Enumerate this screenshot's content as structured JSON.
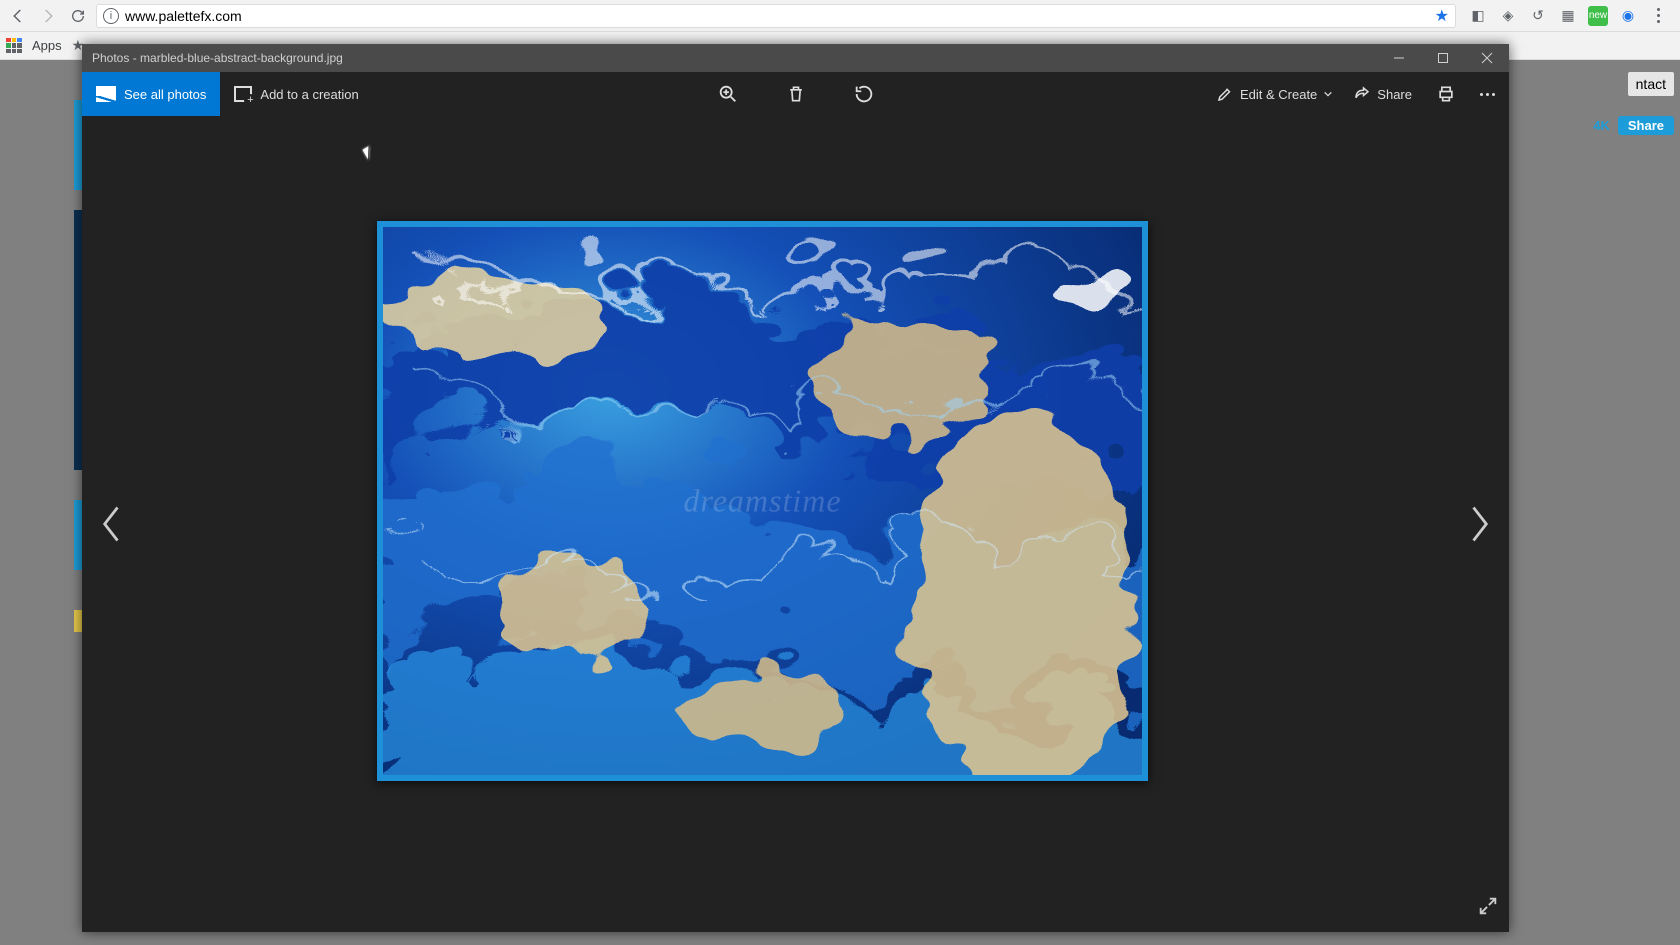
{
  "browser": {
    "url": "www.palettefx.com",
    "apps_label": "Apps",
    "star_filled": true
  },
  "page_strip": {
    "partial_nav": "ntact",
    "k4": "4K",
    "share": "Share"
  },
  "photos": {
    "titlebar": "Photos - marbled-blue-abstract-background.jpg",
    "see_all_label": "See all photos",
    "add_creation_label": "Add to a creation",
    "edit_create_label": "Edit & Create",
    "share_label": "Share",
    "watermark": "dreamstime"
  }
}
